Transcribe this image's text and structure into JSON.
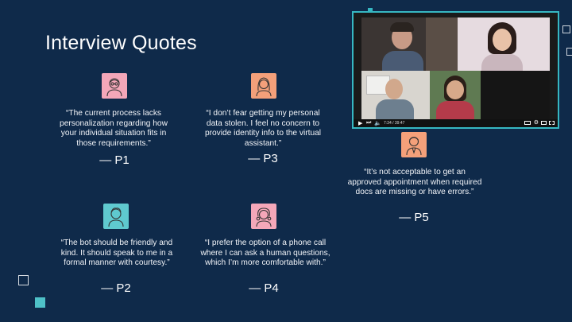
{
  "slide": {
    "title": "Interview Quotes"
  },
  "quotes": [
    {
      "id": "p1",
      "text": "“The current process lacks personalization regarding how your individual situation fits in those requirements.”",
      "attribution": "— P1",
      "avatar_color": "#f4a7b9",
      "avatar_icon": "woman-glasses-icon"
    },
    {
      "id": "p3",
      "text": "“I don’t fear getting my personal data stolen. I feel no concern to provide identity info to the virtual assistant.”",
      "attribution": "— P3",
      "avatar_color": "#f4a07a",
      "avatar_icon": "woman-long-hair-icon"
    },
    {
      "id": "p5",
      "text": "“It’s not acceptable to get an approved appointment when required docs are missing or have errors.”",
      "attribution": "— P5",
      "avatar_color": "#f4a07a",
      "avatar_icon": "man-suit-icon"
    },
    {
      "id": "p2",
      "text": "“The bot should be friendly and kind. It should speak to me in a formal manner with courtesy.”",
      "attribution": "— P2",
      "avatar_color": "#5fc9cf",
      "avatar_icon": "man-short-hair-icon"
    },
    {
      "id": "p4",
      "text": "“I prefer the option of a phone call where I can ask a human questions, which I’m more comfortable with.”",
      "attribution": "— P4",
      "avatar_color": "#f4a7b9",
      "avatar_icon": "woman-curly-hair-icon"
    }
  ],
  "video": {
    "border_color": "#36b7c2",
    "time_label": "7:34 / 39:47",
    "progress": 0.19
  }
}
